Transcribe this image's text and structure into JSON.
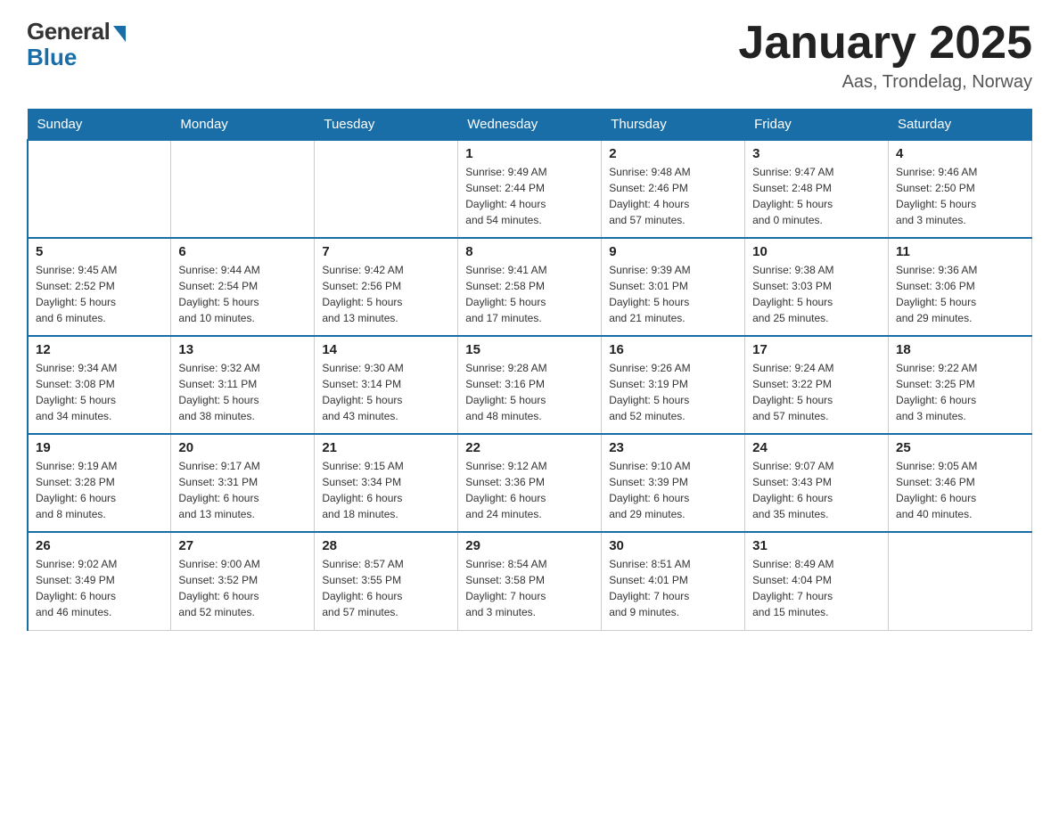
{
  "logo": {
    "general": "General",
    "blue": "Blue"
  },
  "header": {
    "title": "January 2025",
    "subtitle": "Aas, Trondelag, Norway"
  },
  "columns": [
    "Sunday",
    "Monday",
    "Tuesday",
    "Wednesday",
    "Thursday",
    "Friday",
    "Saturday"
  ],
  "weeks": [
    [
      {
        "day": "",
        "info": ""
      },
      {
        "day": "",
        "info": ""
      },
      {
        "day": "",
        "info": ""
      },
      {
        "day": "1",
        "info": "Sunrise: 9:49 AM\nSunset: 2:44 PM\nDaylight: 4 hours\nand 54 minutes."
      },
      {
        "day": "2",
        "info": "Sunrise: 9:48 AM\nSunset: 2:46 PM\nDaylight: 4 hours\nand 57 minutes."
      },
      {
        "day": "3",
        "info": "Sunrise: 9:47 AM\nSunset: 2:48 PM\nDaylight: 5 hours\nand 0 minutes."
      },
      {
        "day": "4",
        "info": "Sunrise: 9:46 AM\nSunset: 2:50 PM\nDaylight: 5 hours\nand 3 minutes."
      }
    ],
    [
      {
        "day": "5",
        "info": "Sunrise: 9:45 AM\nSunset: 2:52 PM\nDaylight: 5 hours\nand 6 minutes."
      },
      {
        "day": "6",
        "info": "Sunrise: 9:44 AM\nSunset: 2:54 PM\nDaylight: 5 hours\nand 10 minutes."
      },
      {
        "day": "7",
        "info": "Sunrise: 9:42 AM\nSunset: 2:56 PM\nDaylight: 5 hours\nand 13 minutes."
      },
      {
        "day": "8",
        "info": "Sunrise: 9:41 AM\nSunset: 2:58 PM\nDaylight: 5 hours\nand 17 minutes."
      },
      {
        "day": "9",
        "info": "Sunrise: 9:39 AM\nSunset: 3:01 PM\nDaylight: 5 hours\nand 21 minutes."
      },
      {
        "day": "10",
        "info": "Sunrise: 9:38 AM\nSunset: 3:03 PM\nDaylight: 5 hours\nand 25 minutes."
      },
      {
        "day": "11",
        "info": "Sunrise: 9:36 AM\nSunset: 3:06 PM\nDaylight: 5 hours\nand 29 minutes."
      }
    ],
    [
      {
        "day": "12",
        "info": "Sunrise: 9:34 AM\nSunset: 3:08 PM\nDaylight: 5 hours\nand 34 minutes."
      },
      {
        "day": "13",
        "info": "Sunrise: 9:32 AM\nSunset: 3:11 PM\nDaylight: 5 hours\nand 38 minutes."
      },
      {
        "day": "14",
        "info": "Sunrise: 9:30 AM\nSunset: 3:14 PM\nDaylight: 5 hours\nand 43 minutes."
      },
      {
        "day": "15",
        "info": "Sunrise: 9:28 AM\nSunset: 3:16 PM\nDaylight: 5 hours\nand 48 minutes."
      },
      {
        "day": "16",
        "info": "Sunrise: 9:26 AM\nSunset: 3:19 PM\nDaylight: 5 hours\nand 52 minutes."
      },
      {
        "day": "17",
        "info": "Sunrise: 9:24 AM\nSunset: 3:22 PM\nDaylight: 5 hours\nand 57 minutes."
      },
      {
        "day": "18",
        "info": "Sunrise: 9:22 AM\nSunset: 3:25 PM\nDaylight: 6 hours\nand 3 minutes."
      }
    ],
    [
      {
        "day": "19",
        "info": "Sunrise: 9:19 AM\nSunset: 3:28 PM\nDaylight: 6 hours\nand 8 minutes."
      },
      {
        "day": "20",
        "info": "Sunrise: 9:17 AM\nSunset: 3:31 PM\nDaylight: 6 hours\nand 13 minutes."
      },
      {
        "day": "21",
        "info": "Sunrise: 9:15 AM\nSunset: 3:34 PM\nDaylight: 6 hours\nand 18 minutes."
      },
      {
        "day": "22",
        "info": "Sunrise: 9:12 AM\nSunset: 3:36 PM\nDaylight: 6 hours\nand 24 minutes."
      },
      {
        "day": "23",
        "info": "Sunrise: 9:10 AM\nSunset: 3:39 PM\nDaylight: 6 hours\nand 29 minutes."
      },
      {
        "day": "24",
        "info": "Sunrise: 9:07 AM\nSunset: 3:43 PM\nDaylight: 6 hours\nand 35 minutes."
      },
      {
        "day": "25",
        "info": "Sunrise: 9:05 AM\nSunset: 3:46 PM\nDaylight: 6 hours\nand 40 minutes."
      }
    ],
    [
      {
        "day": "26",
        "info": "Sunrise: 9:02 AM\nSunset: 3:49 PM\nDaylight: 6 hours\nand 46 minutes."
      },
      {
        "day": "27",
        "info": "Sunrise: 9:00 AM\nSunset: 3:52 PM\nDaylight: 6 hours\nand 52 minutes."
      },
      {
        "day": "28",
        "info": "Sunrise: 8:57 AM\nSunset: 3:55 PM\nDaylight: 6 hours\nand 57 minutes."
      },
      {
        "day": "29",
        "info": "Sunrise: 8:54 AM\nSunset: 3:58 PM\nDaylight: 7 hours\nand 3 minutes."
      },
      {
        "day": "30",
        "info": "Sunrise: 8:51 AM\nSunset: 4:01 PM\nDaylight: 7 hours\nand 9 minutes."
      },
      {
        "day": "31",
        "info": "Sunrise: 8:49 AM\nSunset: 4:04 PM\nDaylight: 7 hours\nand 15 minutes."
      },
      {
        "day": "",
        "info": ""
      }
    ]
  ]
}
